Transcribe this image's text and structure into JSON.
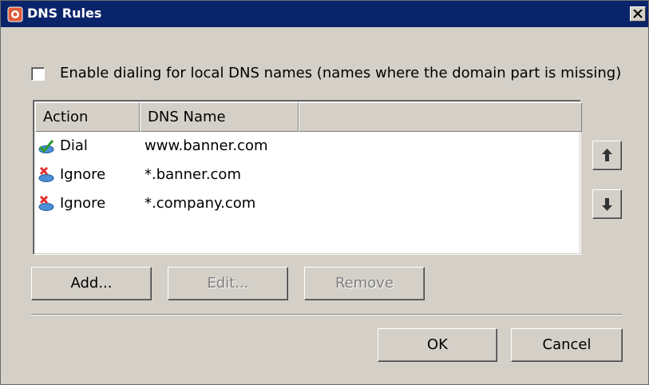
{
  "window": {
    "title": "DNS Rules",
    "close_symbol": "×"
  },
  "options": {
    "enable_local_dns_label": "Enable dialing for local DNS names (names where the domain part is missing)",
    "enable_local_dns_checked": false
  },
  "list": {
    "columns": [
      "Action",
      "DNS Name",
      ""
    ],
    "rows": [
      {
        "action": "Dial",
        "dns_name": "www.banner.com",
        "icon": "dial-icon"
      },
      {
        "action": "Ignore",
        "dns_name": "*.banner.com",
        "icon": "ignore-icon"
      },
      {
        "action": "Ignore",
        "dns_name": "*.company.com",
        "icon": "ignore-icon"
      }
    ]
  },
  "buttons": {
    "add": "Add...",
    "edit": "Edit...",
    "remove": "Remove",
    "ok": "OK",
    "cancel": "Cancel"
  },
  "icons": {
    "move_up": "arrow-up-icon",
    "move_down": "arrow-down-icon"
  },
  "colors": {
    "titlebar": "#0a246a",
    "face": "#d4d0c8",
    "disabled_text": "#808080"
  }
}
